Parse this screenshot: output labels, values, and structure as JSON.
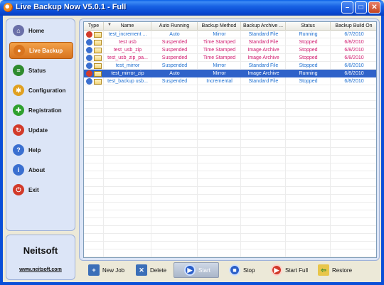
{
  "window": {
    "title": "Live Backup Now V5.0.1 - Full"
  },
  "sidebar": {
    "items": [
      {
        "label": "Home",
        "icon": "house-icon",
        "color": "#6a6fa8",
        "glyph": "⌂",
        "active": false
      },
      {
        "label": "Live Backup",
        "icon": "live-backup-icon",
        "color": "#d8741e",
        "glyph": "●",
        "active": true
      },
      {
        "label": "Status",
        "icon": "status-bars-icon",
        "color": "#2e8b2e",
        "glyph": "≡",
        "active": false
      },
      {
        "label": "Configuration",
        "icon": "configuration-gear-icon",
        "color": "#e0a020",
        "glyph": "✱",
        "active": false
      },
      {
        "label": "Registration",
        "icon": "registration-icon",
        "color": "#2ea02e",
        "glyph": "✚",
        "active": false
      },
      {
        "label": "Update",
        "icon": "update-icon",
        "color": "#d23a2a",
        "glyph": "↻",
        "active": false
      },
      {
        "label": "Help",
        "icon": "help-icon",
        "color": "#3a6fd0",
        "glyph": "?",
        "active": false
      },
      {
        "label": "About",
        "icon": "about-icon",
        "color": "#3a6fd0",
        "glyph": "i",
        "active": false
      },
      {
        "label": "Exit",
        "icon": "exit-icon",
        "color": "#d23a2a",
        "glyph": "⏻",
        "active": false
      }
    ],
    "brand": {
      "name": "Neitsoft",
      "url": "www.neitsoft.com"
    }
  },
  "table": {
    "columns": [
      "Type",
      "Name",
      "Auto Running",
      "Backup Method",
      "Backup Archive ...",
      "Status",
      "Backup Build On"
    ],
    "rows": [
      {
        "name": "test_increment ...",
        "auto": "Auto",
        "method": "Mirror",
        "archive": "Standard File",
        "status": "Running",
        "built": "6/7/2010",
        "color": "#1e6fd0",
        "icon": "#d23a2a",
        "selected": false
      },
      {
        "name": "test usb",
        "auto": "Suspended",
        "method": "Time Stamped",
        "archive": "Standard File",
        "status": "Stopped",
        "built": "6/8/2010",
        "color": "#d0196e",
        "icon": "#3a6fd0",
        "selected": false
      },
      {
        "name": "test_usb_zip",
        "auto": "Suspended",
        "method": "Time Stamped",
        "archive": "Image Archive",
        "status": "Stopped",
        "built": "6/8/2010",
        "color": "#d0196e",
        "icon": "#3a6fd0",
        "selected": false
      },
      {
        "name": "test_usb_zip_pa...",
        "auto": "Suspended",
        "method": "Time Stamped",
        "archive": "Image Archive",
        "status": "Stopped",
        "built": "6/8/2010",
        "color": "#d0196e",
        "icon": "#3a6fd0",
        "selected": false
      },
      {
        "name": "test_mirror",
        "auto": "Suspended",
        "method": "Mirror",
        "archive": "Standard File",
        "status": "Stopped",
        "built": "6/8/2010",
        "color": "#1e6fd0",
        "icon": "#3a6fd0",
        "selected": false
      },
      {
        "name": "test_mirror_zip",
        "auto": "Auto",
        "method": "Mirror",
        "archive": "Image Archive",
        "status": "Running",
        "built": "6/8/2010",
        "color": "#ffffff",
        "icon": "#d23a2a",
        "selected": true
      },
      {
        "name": "test_backup usb...",
        "auto": "Suspended",
        "method": "Incremental",
        "archive": "Standard File",
        "status": "Stopped",
        "built": "6/8/2010",
        "color": "#1e6fd0",
        "icon": "#3a6fd0",
        "selected": false
      }
    ]
  },
  "toolbar": {
    "new_job": "New Job",
    "delete": "Delete",
    "start": "Start",
    "stop": "Stop",
    "start_full": "Start Full",
    "restore": "Restore"
  }
}
